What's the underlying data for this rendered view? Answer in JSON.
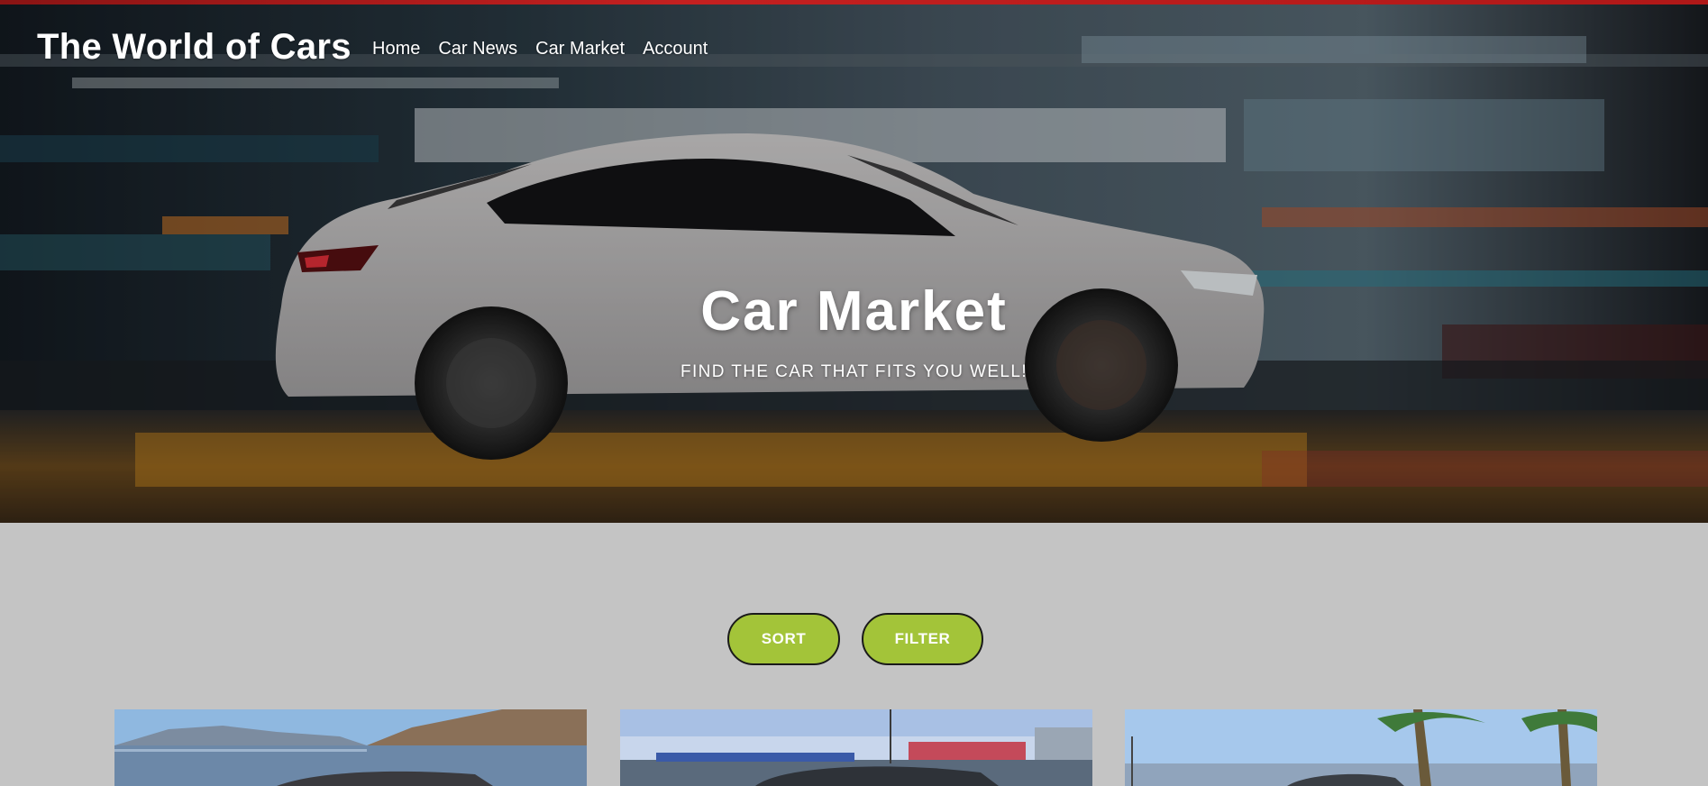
{
  "header": {
    "brand": "The World of Cars",
    "nav": [
      {
        "label": "Home"
      },
      {
        "label": "Car News"
      },
      {
        "label": "Car Market"
      },
      {
        "label": "Account"
      }
    ]
  },
  "hero": {
    "title": "Car Market",
    "subtitle": "FIND THE CAR THAT FITS YOU WELL!"
  },
  "controls": {
    "sort_label": "SORT",
    "filter_label": "FILTER"
  },
  "listings": [
    {
      "image": "car-by-the-sea-photo"
    },
    {
      "image": "car-in-parking-lot-photo"
    },
    {
      "image": "car-with-palm-trees-photo"
    }
  ],
  "colors": {
    "accent_button": "#a3c439",
    "page_background": "#c4c4c4",
    "top_stripe": "#c42020"
  }
}
